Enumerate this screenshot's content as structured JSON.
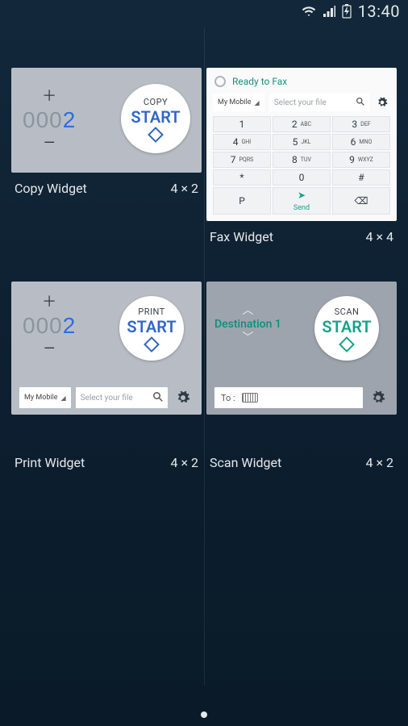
{
  "status": {
    "time": "13:40"
  },
  "widgets": [
    {
      "id": "copy",
      "title": "Copy Widget",
      "size": "4 × 2",
      "counter_prefix": "000",
      "counter_last": "2",
      "circle_title": "COPY",
      "circle_start": "START"
    },
    {
      "id": "fax",
      "title": "Fax Widget",
      "size": "4 × 4",
      "header_text": "Ready to Fax",
      "file_source": "My Mobile",
      "file_placeholder": "Select your file",
      "keys": [
        {
          "n": "1",
          "t": ""
        },
        {
          "n": "2",
          "t": "ABC"
        },
        {
          "n": "3",
          "t": "DEF"
        },
        {
          "n": "4",
          "t": "GHI"
        },
        {
          "n": "5",
          "t": "JKL"
        },
        {
          "n": "6",
          "t": "MNO"
        },
        {
          "n": "7",
          "t": "PQRS"
        },
        {
          "n": "8",
          "t": "TUV"
        },
        {
          "n": "9",
          "t": "WXYZ"
        },
        {
          "n": "*",
          "t": ""
        },
        {
          "n": "0",
          "t": ""
        },
        {
          "n": "#",
          "t": ""
        }
      ],
      "send_label": "Send",
      "pause_label": "P",
      "back_label": "⌫"
    },
    {
      "id": "print",
      "title": "Print Widget",
      "size": "4 × 2",
      "counter_prefix": "000",
      "counter_last": "2",
      "circle_title": "PRINT",
      "circle_start": "START",
      "file_source": "My Mobile",
      "file_placeholder": "Select your file"
    },
    {
      "id": "scan",
      "title": "Scan Widget",
      "size": "4 × 2",
      "dest_label": "Destination 1",
      "circle_title": "SCAN",
      "circle_start": "START",
      "to_label": "To :"
    }
  ]
}
